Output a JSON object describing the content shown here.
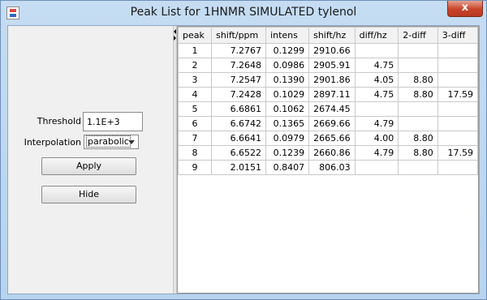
{
  "window": {
    "title": "Peak List for 1HNMR SIMULATED tylenol",
    "close_glyph": "x",
    "icon": "java-app-icon"
  },
  "controls": {
    "threshold_label": "Threshold",
    "threshold_value": "1.1E+3",
    "interpolation_label": "Interpolation",
    "interpolation_value": "parabolic",
    "apply_label": "Apply",
    "hide_label": "Hide"
  },
  "table": {
    "columns": [
      "peak",
      "shift/ppm",
      "intens",
      "shift/hz",
      "diff/hz",
      "2-diff",
      "3-diff"
    ],
    "rows": [
      [
        "1",
        "7.2767",
        "0.1299",
        "2910.66",
        "",
        "",
        ""
      ],
      [
        "2",
        "7.2648",
        "0.0986",
        "2905.91",
        "4.75",
        "",
        ""
      ],
      [
        "3",
        "7.2547",
        "0.1390",
        "2901.86",
        "4.05",
        "8.80",
        ""
      ],
      [
        "4",
        "7.2428",
        "0.1029",
        "2897.11",
        "4.75",
        "8.80",
        "17.59"
      ],
      [
        "5",
        "6.6861",
        "0.1062",
        "2674.45",
        "",
        "",
        ""
      ],
      [
        "6",
        "6.6742",
        "0.1365",
        "2669.66",
        "4.79",
        "",
        ""
      ],
      [
        "7",
        "6.6641",
        "0.0979",
        "2665.66",
        "4.00",
        "8.80",
        ""
      ],
      [
        "8",
        "6.6522",
        "0.1239",
        "2660.86",
        "4.79",
        "8.80",
        "17.59"
      ],
      [
        "9",
        "2.0151",
        "0.8407",
        "806.03",
        "",
        "",
        ""
      ]
    ]
  }
}
